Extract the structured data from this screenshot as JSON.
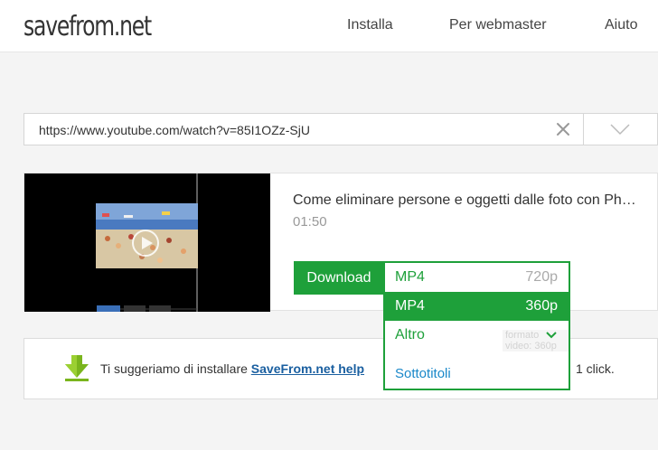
{
  "header": {
    "logo": "savefrom.net",
    "nav": [
      "Installa",
      "Per webmaster",
      "Aiuto"
    ]
  },
  "search": {
    "url": "https://www.youtube.com/watch?v=85I1OZz-SjU",
    "clear_icon": "close-icon",
    "dropdown_icon": "chevron-down-icon"
  },
  "video": {
    "title": "Come eliminare persone e oggetti dalle foto con Photoshop",
    "duration": "01:50",
    "download_label": "Download"
  },
  "formats": {
    "options": [
      {
        "format": "MP4",
        "resolution": "720p"
      },
      {
        "format": "MP4",
        "resolution": "360p"
      }
    ],
    "more_label": "Altro",
    "ghost_text": "formato video: 360p",
    "subtitles_label": "Sottotitoli"
  },
  "suggestion": {
    "prefix": "Ti suggeriamo di installare",
    "link": "SaveFrom.net help",
    "suffix": "1 click."
  },
  "colors": {
    "accent": "#1ea03a",
    "link": "#1a5fa0",
    "subtitles": "#1a88c9"
  }
}
